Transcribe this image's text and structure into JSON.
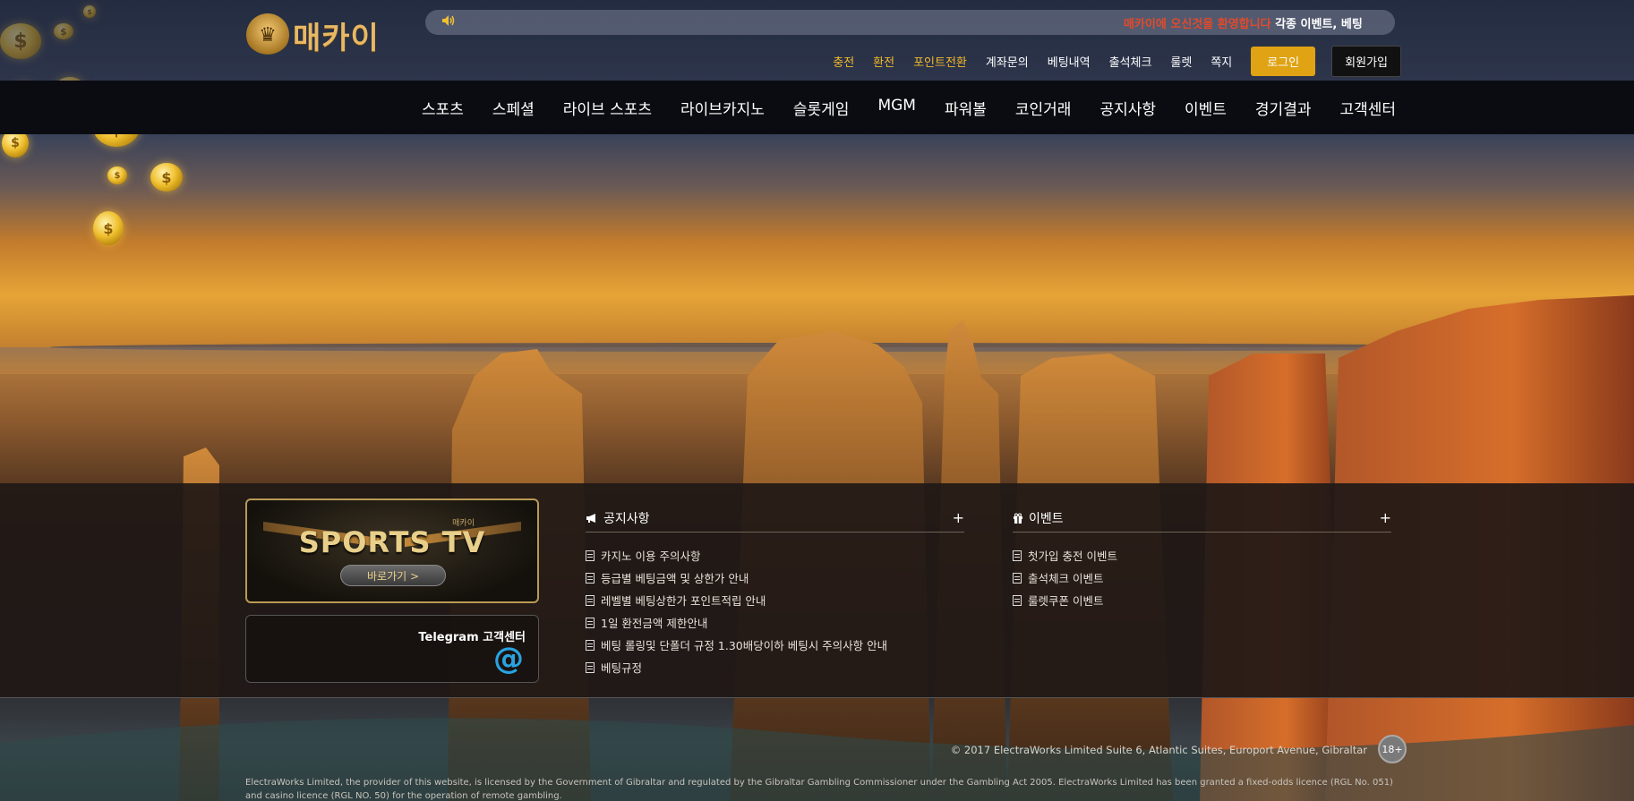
{
  "header": {
    "logo_text": "매카이",
    "ticker_highlight": "매카이에 오신것을 환영합니다",
    "ticker_rest": "각종 이벤트, 베팅",
    "util_links": [
      {
        "label": "충전",
        "gold": true
      },
      {
        "label": "환전",
        "gold": true
      },
      {
        "label": "포인트전환",
        "gold": true
      },
      {
        "label": "계좌문의",
        "gold": false
      },
      {
        "label": "베팅내역",
        "gold": false
      },
      {
        "label": "출석체크",
        "gold": false
      },
      {
        "label": "룰렛",
        "gold": false
      },
      {
        "label": "쪽지",
        "gold": false
      }
    ],
    "login_label": "로그인",
    "join_label": "회원가입"
  },
  "mainnav": {
    "items": [
      "스포츠",
      "스페셜",
      "라이브 스포츠",
      "라이브카지노",
      "슬롯게임",
      "MGM",
      "파워볼",
      "코인거래",
      "공지사항",
      "이벤트",
      "경기결과",
      "고객센터"
    ]
  },
  "sports_tv": {
    "brand": "매카이",
    "title": "SPORTS TV",
    "button": "바로가기 >"
  },
  "telegram": {
    "label": "Telegram 고객센터",
    "symbol": "@"
  },
  "notice_board": {
    "title": "공지사항",
    "plus": "+",
    "items": [
      "카지노 이용 주의사항",
      "등급별 베팅금액 및 상한가 안내",
      "레벨별 베팅상한가 포인트적립 안내",
      "1일 환전금액 제한안내",
      "베팅 롤링및 단폴더 규정 1.30배당이하 베팅시 주의사항 안내",
      "베팅규정"
    ]
  },
  "event_board": {
    "title": "이벤트",
    "plus": "+",
    "items": [
      "첫가입 충전 이벤트",
      "출석체크 이벤트",
      "룰렛쿠폰 이벤트"
    ]
  },
  "footer": {
    "copyright": "© 2017 ElectraWorks Limited Suite 6, Atlantic Suites, Europort Avenue, Gibraltar",
    "age": "18+",
    "license": "ElectraWorks Limited, the provider of this website, is licensed by the Government of Gibraltar and regulated by the Gibraltar Gambling Commissioner under the Gambling Act 2005. ElectraWorks Limited has been granted a fixed-odds licence (RGL No. 051) and casino licence (RGL NO. 50) for the operation of remote gambling."
  },
  "colors": {
    "accent_gold": "#e0a314",
    "nav_bg": "#0b0c12",
    "telegram_blue": "#29a3e0",
    "ticker_red": "#e24a2a"
  }
}
